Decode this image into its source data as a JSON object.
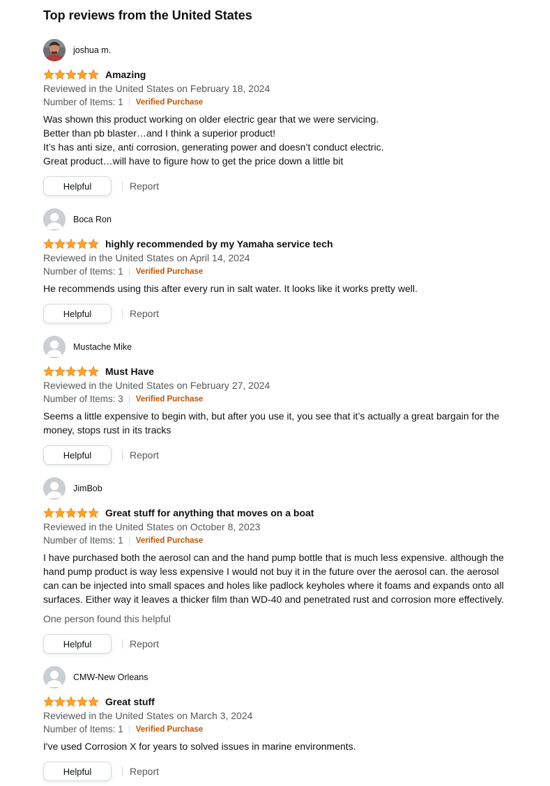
{
  "section_title": "Top reviews from the United States",
  "colors": {
    "star": "#ffa41c",
    "verified": "#c45500",
    "meta": "#565959"
  },
  "reviews": [
    {
      "username": "joshua m.",
      "avatar": "photo-avatar",
      "rating": "5 out of 5 stars",
      "title": "Amazing",
      "date": "Reviewed in the United States on February 18, 2024",
      "items": "Number of Items: 1",
      "verified": "Verified Purchase",
      "body": [
        "Was shown this product working on older electric gear that we were servicing.",
        "Better than pb blaster…and I think a superior product!",
        "It’s has anti size, anti corrosion, generating power and doesn’t conduct electric.",
        "Great product…will have to figure how to get the price down a little bit"
      ],
      "helpful_count": "",
      "helpful_label": "Helpful",
      "report_label": "Report"
    },
    {
      "username": "Boca Ron",
      "avatar": "default-avatar",
      "rating": "5 out of 5 stars",
      "title": "highly recommended by my Yamaha service tech",
      "date": "Reviewed in the United States on April 14, 2024",
      "items": "Number of Items: 1",
      "verified": "Verified Purchase",
      "body": [
        "He recommends using this after every run in salt water. It looks like it works pretty well."
      ],
      "helpful_count": "",
      "helpful_label": "Helpful",
      "report_label": "Report"
    },
    {
      "username": "Mustache Mike",
      "avatar": "default-avatar",
      "rating": "5 out of 5 stars",
      "title": "Must Have",
      "date": "Reviewed in the United States on February 27, 2024",
      "items": "Number of Items: 3",
      "verified": "Verified Purchase",
      "body": [
        "Seems a little expensive to begin with, but after you use it, you see that it’s actually a great bargain for the",
        "money, stops rust in its tracks"
      ],
      "helpful_count": "",
      "helpful_label": "Helpful",
      "report_label": "Report"
    },
    {
      "username": "JimBob",
      "avatar": "default-avatar",
      "rating": "5 out of 5 stars",
      "title": "Great stuff for anything that moves on a boat",
      "date": "Reviewed in the United States on October 8, 2023",
      "items": "Number of Items: 1",
      "verified": "Verified Purchase",
      "body": [
        "I have purchased both the aerosol can and the hand pump bottle that is much less expensive. although the",
        "hand pump product is way less expensive I would not buy it in the future over the aerosol can. the aerosol",
        "can can be injected into small spaces and holes like padlock keyholes where it foams and expands onto all",
        "surfaces. Either way it leaves a thicker film than WD-40 and penetrated rust and corrosion more effectively."
      ],
      "helpful_count": "One person found this helpful",
      "helpful_label": "Helpful",
      "report_label": "Report"
    },
    {
      "username": "CMW-New Orleans",
      "avatar": "default-avatar",
      "rating": "5 out of 5 stars",
      "title": "Great stuff",
      "date": "Reviewed in the United States on March 3, 2024",
      "items": "Number of Items: 1",
      "verified": "Verified Purchase",
      "body": [
        "I've used Corrosion X for years to solved issues in marine environments."
      ],
      "helpful_count": "",
      "helpful_label": "Helpful",
      "report_label": "Report"
    }
  ]
}
